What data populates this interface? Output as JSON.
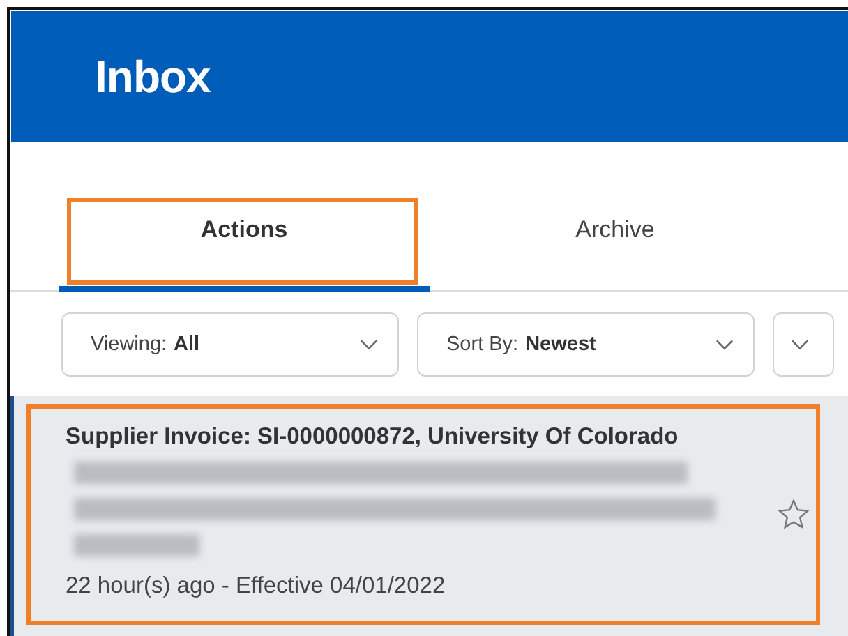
{
  "header": {
    "title": "Inbox"
  },
  "tabs": [
    {
      "label": "Actions",
      "selected": true,
      "highlighted": true
    },
    {
      "label": "Archive",
      "selected": false,
      "highlighted": false
    }
  ],
  "filters": [
    {
      "kind": "select",
      "label": "Viewing:",
      "value": "All"
    },
    {
      "kind": "select",
      "label": "Sort By:",
      "value": "Newest"
    },
    {
      "kind": "menu"
    }
  ],
  "items": [
    {
      "title": "Supplier Invoice: SI-0000000872, University Of Colorado",
      "meta": "22 hour(s) ago - Effective 04/01/2022",
      "starred": false,
      "highlighted": true
    }
  ]
}
